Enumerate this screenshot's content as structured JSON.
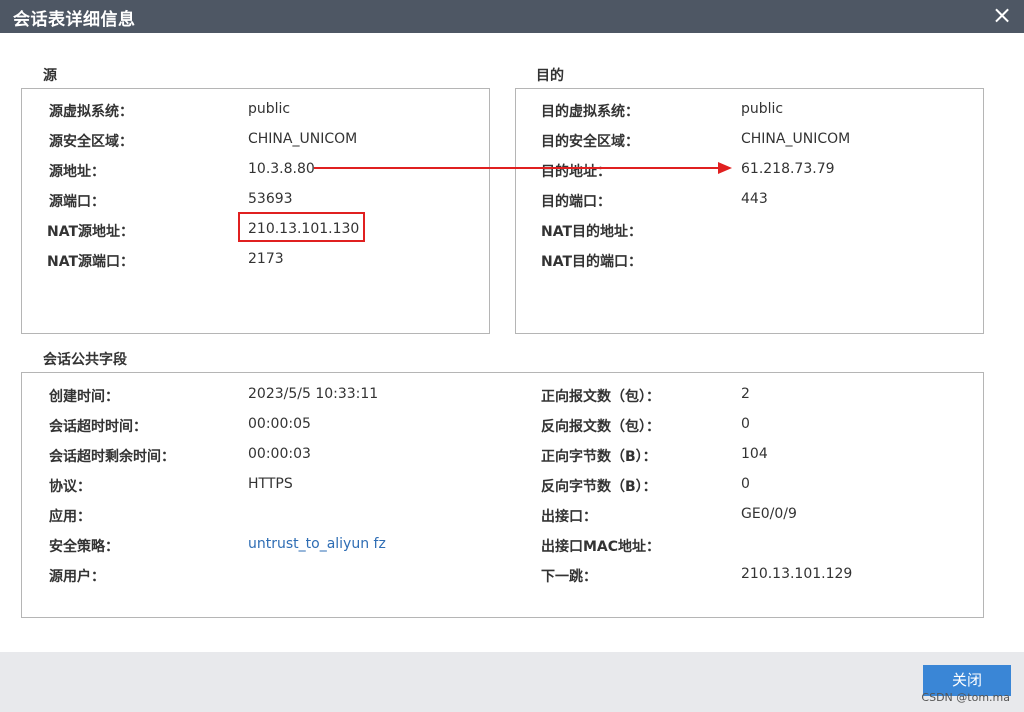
{
  "dialog": {
    "title": "会话表详细信息",
    "close_icon": "×"
  },
  "source": {
    "heading": "源",
    "rows": [
      {
        "label": "源虚拟系统：",
        "value": "public"
      },
      {
        "label": "源安全区域：",
        "value": "CHINA_UNICOM"
      },
      {
        "label": "源地址：",
        "value": "10.3.8.80"
      },
      {
        "label": "源端口：",
        "value": "53693"
      },
      {
        "label": "NAT源地址：",
        "value": "210.13.101.130"
      },
      {
        "label": "NAT源端口：",
        "value": "2173"
      }
    ]
  },
  "destination": {
    "heading": "目的",
    "rows": [
      {
        "label": "目的虚拟系统：",
        "value": "public"
      },
      {
        "label": "目的安全区域：",
        "value": "CHINA_UNICOM"
      },
      {
        "label": "目的地址：",
        "value": "61.218.73.79"
      },
      {
        "label": "目的端口：",
        "value": "443"
      },
      {
        "label": "NAT目的地址：",
        "value": ""
      },
      {
        "label": "NAT目的端口：",
        "value": ""
      }
    ]
  },
  "common": {
    "heading": "会话公共字段",
    "left_rows": [
      {
        "label": "创建时间：",
        "value": "2023/5/5 10:33:11"
      },
      {
        "label": "会话超时时间：",
        "value": "00:00:05"
      },
      {
        "label": "会话超时剩余时间：",
        "value": "00:00:03"
      },
      {
        "label": "协议：",
        "value": "HTTPS"
      },
      {
        "label": "应用：",
        "value": ""
      },
      {
        "label": "安全策略：",
        "value": "untrust_to_aliyun fz"
      },
      {
        "label": "源用户：",
        "value": ""
      }
    ],
    "right_rows": [
      {
        "label": "正向报文数（包）：",
        "value": "2"
      },
      {
        "label": "反向报文数（包）：",
        "value": "0"
      },
      {
        "label": "正向字节数（B）：",
        "value": "104"
      },
      {
        "label": "反向字节数（B）：",
        "value": "0"
      },
      {
        "label": "出接口：",
        "value": "GE0/0/9"
      },
      {
        "label": "出接口MAC地址：",
        "value": ""
      },
      {
        "label": "下一跳：",
        "value": "210.13.101.129"
      }
    ]
  },
  "footer": {
    "close_label": "关闭",
    "watermark": "CSDN @tom.ma"
  },
  "colors": {
    "titlebar": "#4e5764",
    "link": "#2e6db4",
    "annotation": "#e02020",
    "button": "#3a86d6"
  }
}
